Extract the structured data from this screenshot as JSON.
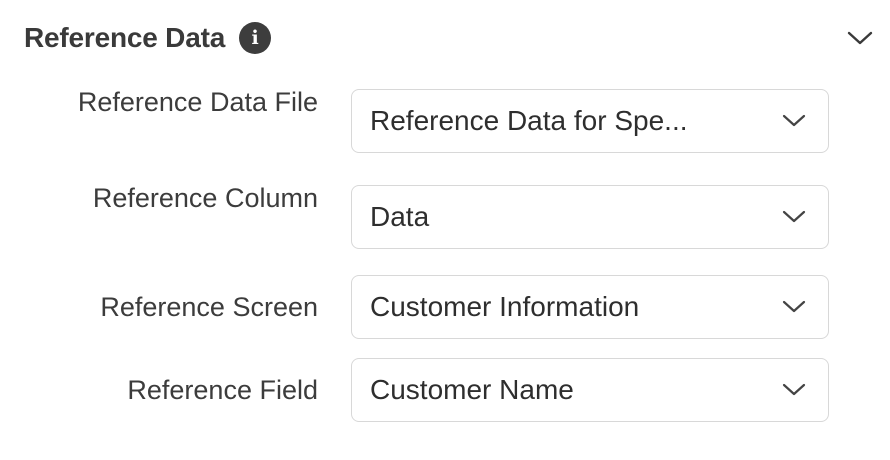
{
  "section": {
    "title": "Reference Data",
    "info_icon": "info-icon",
    "toggle_icon": "chevron-down-icon"
  },
  "fields": [
    {
      "label": "Reference Data File",
      "value": "Reference Data for Spe..."
    },
    {
      "label": "Reference Column",
      "value": "Data"
    },
    {
      "label": "Reference Screen",
      "value": "Customer Information"
    },
    {
      "label": "Reference Field",
      "value": "Customer Name"
    }
  ],
  "colors": {
    "text": "#3c3c3c",
    "border": "#d8d8d8",
    "icon_bg": "#3d3d3d"
  }
}
